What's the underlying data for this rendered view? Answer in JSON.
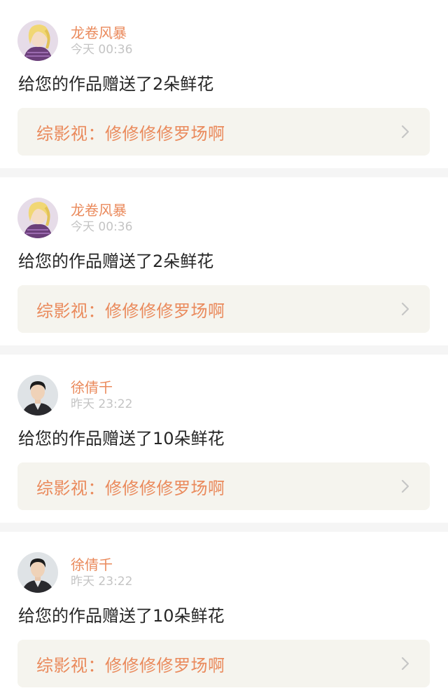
{
  "items": [
    {
      "username": "龙卷风暴",
      "time": "今天 00:36",
      "message": "给您的作品赠送了2朵鲜花",
      "work_title": "综影视：修修修修罗场啊",
      "avatar_icon": "anime-girl-avatar"
    },
    {
      "username": "龙卷风暴",
      "time": "今天 00:36",
      "message": "给您的作品赠送了2朵鲜花",
      "work_title": "综影视：修修修修罗场啊",
      "avatar_icon": "anime-girl-avatar"
    },
    {
      "username": "徐倩千",
      "time": "昨天 23:22",
      "message": "给您的作品赠送了10朵鲜花",
      "work_title": "综影视：修修修修罗场啊",
      "avatar_icon": "man-portrait-avatar"
    },
    {
      "username": "徐倩千",
      "time": "昨天 23:22",
      "message": "给您的作品赠送了10朵鲜花",
      "work_title": "综影视：修修修修罗场啊",
      "avatar_icon": "man-portrait-avatar"
    }
  ],
  "colors": {
    "accent": "#ea8a5c",
    "time": "#c4c4c4",
    "text": "#262626",
    "box": "#f5f4ee",
    "divider": "#f5f5f5"
  }
}
